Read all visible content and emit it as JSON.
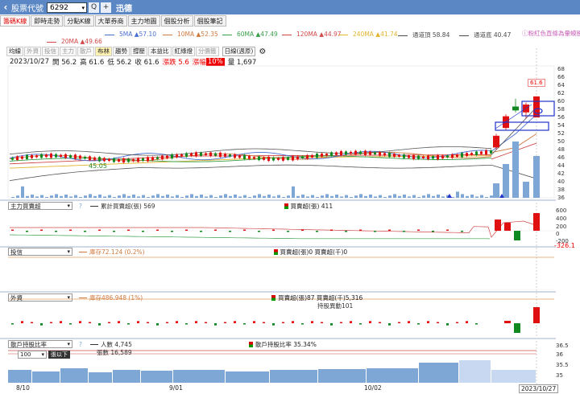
{
  "topbar": {
    "label": "股票代號",
    "code": "6292",
    "name": "迅德",
    "search_glyph": "Q",
    "plus_glyph": "+"
  },
  "tabs": [
    "籌碼K線",
    "即時走勢",
    "分點K線",
    "大單券商",
    "主力地圖",
    "個股分析",
    "個股筆記"
  ],
  "ma_legend": [
    {
      "text": "5MA ▲57.10",
      "color": "#4a6fd0"
    },
    {
      "text": "10MA ▲52.35",
      "color": "#d07a40"
    },
    {
      "text": "60MA ▲47.49",
      "color": "#39a04a"
    },
    {
      "text": "120MA ▲44.97",
      "color": "#d04a4a"
    },
    {
      "text": "240MA ▲41.74",
      "color": "#e3b530"
    },
    {
      "text": "通道頂 58.84",
      "color": "#4a4a4a"
    },
    {
      "text": "通道底 40.47",
      "color": "#4a4a4a"
    },
    {
      "text": "20MA ▲49.66",
      "color": "#d04a4a"
    }
  ],
  "hint": "粉紅色直條為暈蟆股",
  "indicator_tabs": [
    "均線",
    "外資",
    "投信",
    "主力",
    "散戶",
    "布林",
    "趨勢",
    "撐壓",
    "本益比",
    "紅綠燈",
    "分價籤"
  ],
  "period": "日線(週原)",
  "ohlc": {
    "date": "2023/10/27",
    "open": "開 56.2",
    "high": "高 61.6",
    "low": "低 56.2",
    "close": "收 61.6",
    "change": "漲跌 5.6",
    "pct_label": "漲幅",
    "pct": "10%",
    "volume": "量 1,697"
  },
  "price_axis": [
    "68",
    "66",
    "64",
    "62",
    "60",
    "58",
    "56",
    "54",
    "52",
    "50",
    "48",
    "46",
    "44",
    "42",
    "40",
    "38",
    "36"
  ],
  "price_callout": "61.6",
  "low_callout": "45.05",
  "panels": {
    "main_force": {
      "select": "主力買賣超",
      "q": "?",
      "leg1": "累計買賣超(張) 569",
      "leg2": "買賣超(張) 411",
      "axis": [
        "600",
        "400",
        "200",
        "0",
        "-200"
      ]
    },
    "trust": {
      "select": "投信",
      "leg1": "庫存72.124 (0.2%)",
      "leg2": "買賣超(張)0 買賣超(千)0",
      "axis_value": "-326.1"
    },
    "foreign": {
      "select": "外資",
      "leg1": "庫存486.948 (1%)",
      "leg2": "買賣超(張)87 買賣超(千)5,316",
      "leg3": "持股異動101"
    },
    "holders": {
      "select": "散戶持股比率",
      "q": "?",
      "leg1": "人數 4,745",
      "leg1b": "張數 16,589",
      "leg2": "散戶持股比率 35.34%",
      "axis": [
        "36.5",
        "36",
        "35.5",
        "35"
      ],
      "dropdown": "100",
      "tag": "張以下"
    }
  },
  "dates": [
    "8/10",
    "9/01",
    "10/02",
    "2023/10/27"
  ],
  "colors": {
    "up": "#e01010",
    "down": "#108a20",
    "volume": "#7ea7d6",
    "frame": "#2233cc"
  },
  "chart_data": {
    "type": "candlestick",
    "title": "",
    "price_ylim": [
      36,
      69
    ],
    "last_candles": [
      {
        "date": "",
        "open": 48.5,
        "high": 52.0,
        "low": 48.0,
        "close": 51.5
      },
      {
        "date": "",
        "open": 53.5,
        "high": 57.0,
        "low": 53.0,
        "close": 56.5
      },
      {
        "date": "",
        "open": 59.0,
        "high": 61.0,
        "low": 57.5,
        "close": 58.0
      },
      {
        "date": "",
        "open": 57.5,
        "high": 60.0,
        "low": 56.0,
        "close": 59.5
      },
      {
        "date": "",
        "open": 57.5,
        "high": 58.8,
        "low": 56.5,
        "close": 58.0
      },
      {
        "date": "2023/10/27",
        "open": 56.2,
        "high": 61.6,
        "low": 56.2,
        "close": 61.6
      }
    ]
  }
}
